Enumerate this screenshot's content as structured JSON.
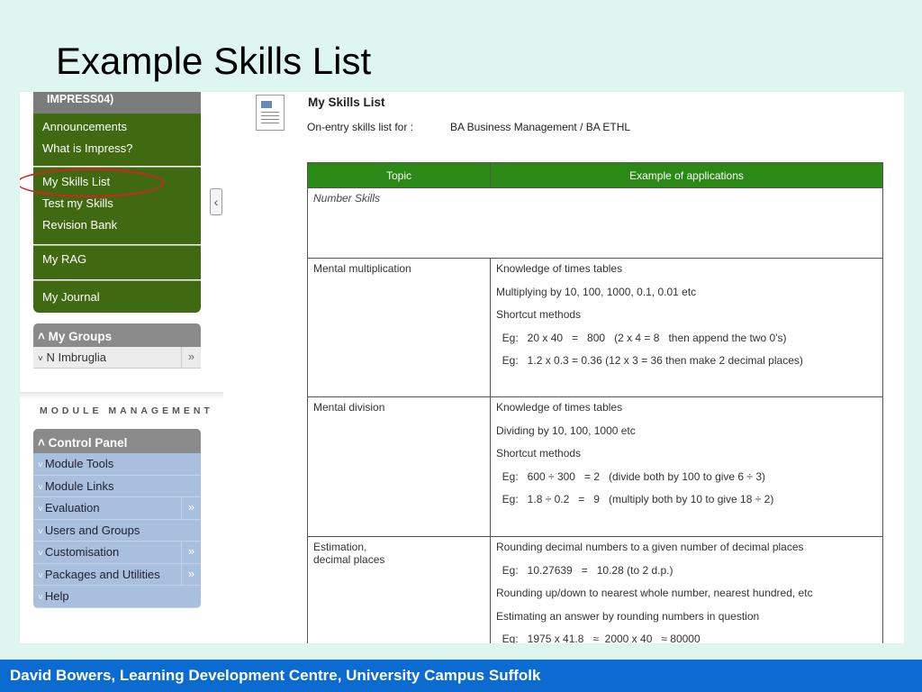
{
  "slide": {
    "title": "Example Skills List",
    "footer": "David Bowers, Learning Development Centre, University Campus Suffolk"
  },
  "sidebar": {
    "top_label": "IMPRESS04)",
    "group1": [
      "Announcements",
      "What is Impress?"
    ],
    "group2": [
      "My Skills List",
      "Test my Skills",
      "Revision Bank"
    ],
    "group3": "My RAG",
    "group4": "My Journal",
    "collapse_icon": "chevron-left-icon",
    "my_groups": {
      "title": "My Groups",
      "items": [
        "N Imbruglia"
      ]
    },
    "module_management": "MODULE MANAGEMENT",
    "control_panel": {
      "title": "Control Panel",
      "items": [
        {
          "label": "Module Tools",
          "has_arrow": false
        },
        {
          "label": "Module Links",
          "has_arrow": false
        },
        {
          "label": "Evaluation",
          "has_arrow": true
        },
        {
          "label": "Users and Groups",
          "has_arrow": false
        },
        {
          "label": "Customisation",
          "has_arrow": true
        },
        {
          "label": "Packages and Utilities",
          "has_arrow": true
        },
        {
          "label": "Help",
          "has_arrow": false
        }
      ]
    }
  },
  "main": {
    "title": "My Skills List",
    "entry_label": "On-entry skills list for :",
    "entry_value": "BA Business Management  /  BA ETHL",
    "table": {
      "headers": [
        "Topic",
        "Example of applications"
      ],
      "section": "Number Skills",
      "rows": [
        {
          "topic": "Mental multiplication",
          "lines": [
            "Knowledge of times tables",
            "Multiplying by 10, 100, 1000, 0.1, 0.01 etc",
            "Shortcut methods",
            "  Eg:   20 x 40   =   800   (2 x 4 = 8   then append the two 0's)",
            "  Eg:   1.2 x 0.3 = 0.36 (12 x 3 = 36 then make 2 decimal places)"
          ]
        },
        {
          "topic": "Mental division",
          "lines": [
            "Knowledge of times tables",
            "Dividing by 10, 100, 1000 etc",
            "Shortcut methods",
            "  Eg:   600 ÷ 300   = 2   (divide both by 100 to give 6 ÷ 3)",
            "  Eg:   1.8 ÷ 0.2   =   9   (multiply both by 10 to give 18 ÷ 2)"
          ]
        },
        {
          "topic": "Estimation,\ndecimal places",
          "lines": [
            "Rounding decimal numbers to a given number of decimal places",
            "  Eg:   10.27639   =   10.28 (to 2 d.p.)",
            "Rounding up/down to nearest whole number, nearest hundred, etc",
            "Estimating an answer by rounding numbers in question",
            "  Eg:   1975 x 41.8   ≈  2000 x 40   ≈ 80000"
          ]
        }
      ]
    }
  }
}
